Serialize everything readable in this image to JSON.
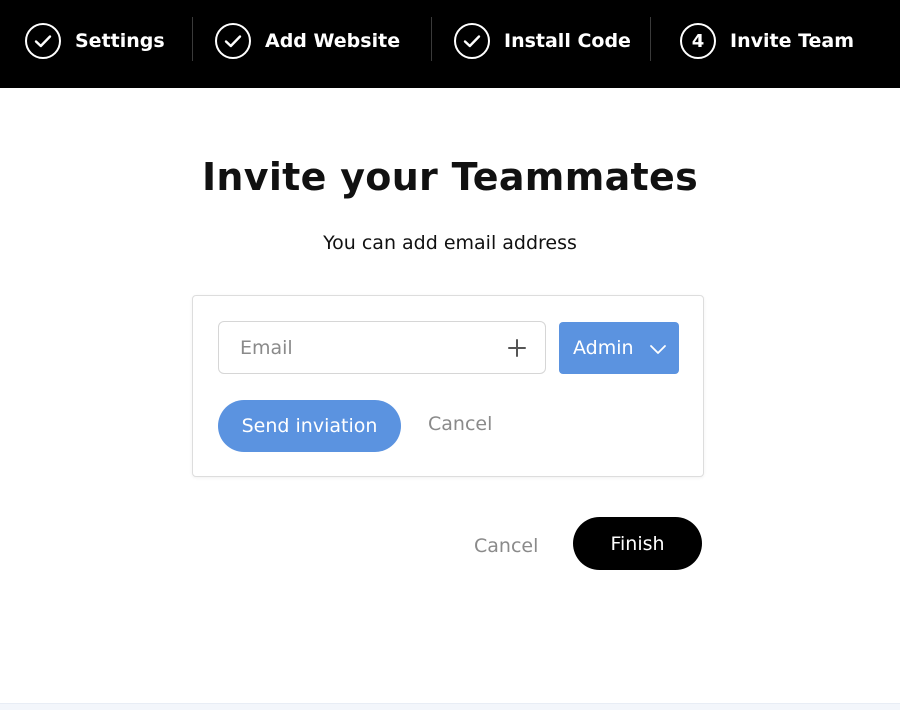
{
  "stepper": {
    "steps": [
      {
        "label": "Settings",
        "state": "done",
        "icon": "check-icon"
      },
      {
        "label": "Add Website",
        "state": "done",
        "icon": "check-icon"
      },
      {
        "label": "Install Code",
        "state": "done",
        "icon": "check-icon"
      },
      {
        "label": "Invite Team",
        "state": "current",
        "number": "4"
      }
    ]
  },
  "main": {
    "title": "Invite your Teammates",
    "subtitle": "You can add email address"
  },
  "invite_card": {
    "email_placeholder": "Email",
    "email_value": "",
    "add_icon": "plus-icon",
    "role": {
      "selected": "Admin",
      "icon": "chevron-down-icon"
    },
    "send_label": "Send inviation",
    "cancel_label": "Cancel"
  },
  "footer": {
    "cancel_label": "Cancel",
    "finish_label": "Finish"
  },
  "colors": {
    "header_bg": "#000000",
    "accent": "#5b93e0",
    "muted_text": "#8a8a8a",
    "finish_bg": "#000000"
  }
}
